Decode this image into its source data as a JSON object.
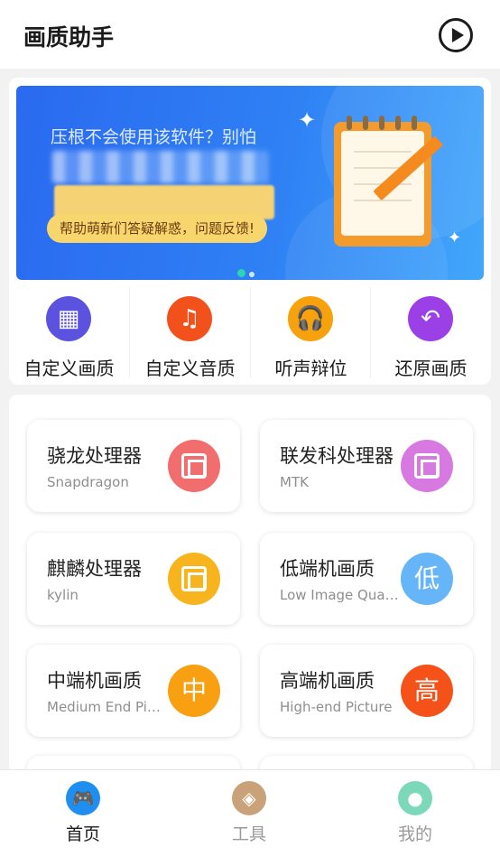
{
  "header": {
    "title": "画质助手",
    "play_icon": "play-circle-icon"
  },
  "banner": {
    "line1": "压根不会使用该软件？别怕",
    "pill": "帮助萌新们答疑解惑，问题反馈!",
    "page_count": 2,
    "active_page": 1
  },
  "quick_actions": [
    {
      "label": "自定义画质",
      "icon": "mosaic-icon",
      "color": "#5b53e0"
    },
    {
      "label": "自定义音质",
      "icon": "music-note-icon",
      "color": "#f2511c"
    },
    {
      "label": "听声辩位",
      "icon": "headphones-icon",
      "color": "#f7a20c"
    },
    {
      "label": "还原画质",
      "icon": "undo-arrow-icon",
      "color": "#9b3fe6"
    }
  ],
  "tiles": [
    {
      "title": "骁龙处理器",
      "subtitle": "Snapdragon",
      "icon": "chip-icon",
      "glyph": "",
      "color": "#f26d6d"
    },
    {
      "title": "联发科处理器",
      "subtitle": "MTK",
      "icon": "chip-icon",
      "glyph": "",
      "color": "#d879e2"
    },
    {
      "title": "麒麟处理器",
      "subtitle": "kylin",
      "icon": "chip-icon",
      "glyph": "",
      "color": "#f7b41c"
    },
    {
      "title": "低端机画质",
      "subtitle": "Low Image Quality",
      "icon": "low-text-icon",
      "glyph": "低",
      "color": "#66b5f8"
    },
    {
      "title": "中端机画质",
      "subtitle": "Medium End Picture",
      "icon": "mid-text-icon",
      "glyph": "中",
      "color": "#f9a012"
    },
    {
      "title": "高端机画质",
      "subtitle": "High-end Picture",
      "icon": "high-text-icon",
      "glyph": "高",
      "color": "#f5521a"
    }
  ],
  "bottom_nav": [
    {
      "label": "首页",
      "icon": "gamepad-icon",
      "color": "#1f8ef1",
      "active": true
    },
    {
      "label": "工具",
      "icon": "box-icon",
      "color": "#c9a27a",
      "active": false
    },
    {
      "label": "我的",
      "icon": "user-icon",
      "color": "#7bd8b8",
      "active": false
    }
  ]
}
